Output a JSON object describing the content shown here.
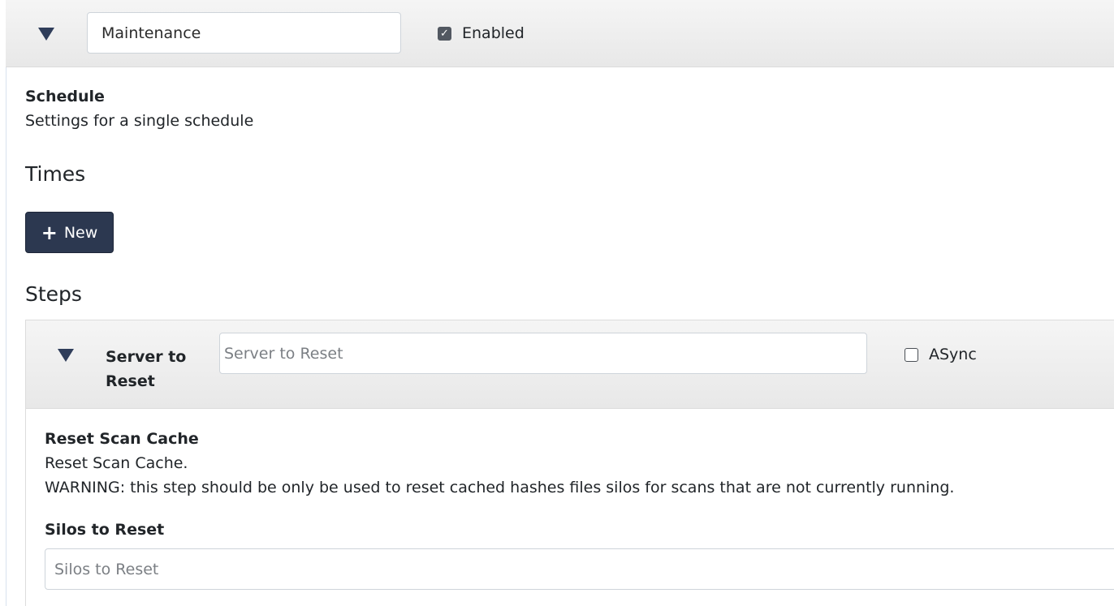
{
  "schedule": {
    "name_value": "Maintenance",
    "enabled_label": "Enabled",
    "enabled_checked": true,
    "title": "Schedule",
    "description": "Settings for a single schedule"
  },
  "times": {
    "heading": "Times",
    "new_button_label": "New",
    "new_button_icon": "plus-icon"
  },
  "steps": {
    "heading": "Steps",
    "step": {
      "type_label": "Server to Reset",
      "name_placeholder": "Server to Reset",
      "async_label": "ASync",
      "async_checked": false,
      "title": "Reset Scan Cache",
      "description_line1": "Reset Scan Cache.",
      "description_line2": "WARNING: this step should be only be used to reset cached hashes files silos for scans that are not currently running.",
      "silos_label": "Silos to Reset",
      "silos_placeholder": "Silos to Reset"
    }
  },
  "colors": {
    "primary_button": "#2c3850",
    "caret": "#2f3d5a",
    "header_bg": "#eeeeee"
  }
}
